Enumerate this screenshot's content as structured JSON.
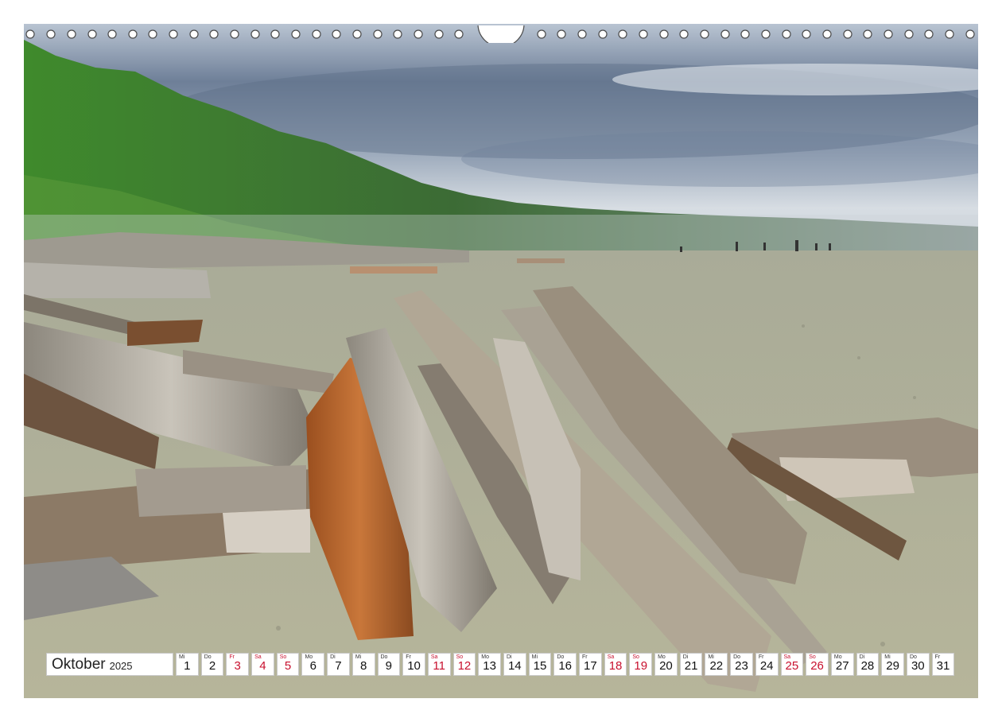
{
  "calendar": {
    "month": "Oktober",
    "year": "2025",
    "days": [
      {
        "dow": "Mi",
        "num": "1",
        "weekend": false
      },
      {
        "dow": "Do",
        "num": "2",
        "weekend": false
      },
      {
        "dow": "Fr",
        "num": "3",
        "weekend": true
      },
      {
        "dow": "Sa",
        "num": "4",
        "weekend": true
      },
      {
        "dow": "So",
        "num": "5",
        "weekend": true
      },
      {
        "dow": "Mo",
        "num": "6",
        "weekend": false
      },
      {
        "dow": "Di",
        "num": "7",
        "weekend": false
      },
      {
        "dow": "Mi",
        "num": "8",
        "weekend": false
      },
      {
        "dow": "Do",
        "num": "9",
        "weekend": false
      },
      {
        "dow": "Fr",
        "num": "10",
        "weekend": false
      },
      {
        "dow": "Sa",
        "num": "11",
        "weekend": true
      },
      {
        "dow": "So",
        "num": "12",
        "weekend": true
      },
      {
        "dow": "Mo",
        "num": "13",
        "weekend": false
      },
      {
        "dow": "Di",
        "num": "14",
        "weekend": false
      },
      {
        "dow": "Mi",
        "num": "15",
        "weekend": false
      },
      {
        "dow": "Do",
        "num": "16",
        "weekend": false
      },
      {
        "dow": "Fr",
        "num": "17",
        "weekend": false
      },
      {
        "dow": "Sa",
        "num": "18",
        "weekend": true
      },
      {
        "dow": "So",
        "num": "19",
        "weekend": true
      },
      {
        "dow": "Mo",
        "num": "20",
        "weekend": false
      },
      {
        "dow": "Di",
        "num": "21",
        "weekend": false
      },
      {
        "dow": "Mi",
        "num": "22",
        "weekend": false
      },
      {
        "dow": "Do",
        "num": "23",
        "weekend": false
      },
      {
        "dow": "Fr",
        "num": "24",
        "weekend": false
      },
      {
        "dow": "Sa",
        "num": "25",
        "weekend": true
      },
      {
        "dow": "So",
        "num": "26",
        "weekend": true
      },
      {
        "dow": "Mo",
        "num": "27",
        "weekend": false
      },
      {
        "dow": "Di",
        "num": "28",
        "weekend": false
      },
      {
        "dow": "Mi",
        "num": "29",
        "weekend": false
      },
      {
        "dow": "Do",
        "num": "30",
        "weekend": false
      },
      {
        "dow": "Fr",
        "num": "31",
        "weekend": false
      }
    ]
  },
  "colors": {
    "weekend": "#c8102e",
    "sky": "#8f9fb4",
    "forest": "#3f7f2c",
    "sand": "#b8b89a",
    "driftwood": "#a9a49a",
    "wood_orange": "#b8642a"
  }
}
